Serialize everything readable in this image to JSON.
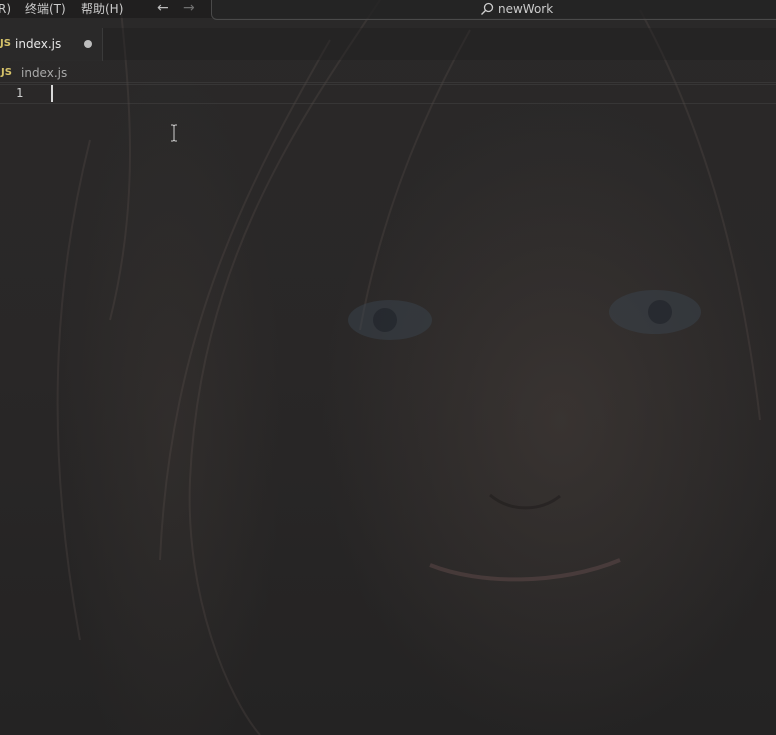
{
  "menu": {
    "items": [
      {
        "id": "selection",
        "label": "R)"
      },
      {
        "id": "terminal",
        "label": "终端(T)"
      },
      {
        "id": "help",
        "label": "帮助(H)"
      }
    ]
  },
  "navigation": {
    "back_icon": "arrow-left-icon",
    "forward_icon": "arrow-right-icon"
  },
  "command_center": {
    "icon": "search-icon",
    "label": "newWork"
  },
  "tabs": [
    {
      "icon_text": "JS",
      "label": "index.js",
      "dirty": true
    }
  ],
  "breadcrumb": {
    "icon_text": "JS",
    "label": "index.js"
  },
  "editor": {
    "lines": [
      {
        "number": "1",
        "text": ""
      }
    ]
  },
  "colors": {
    "js_icon": "#d6c36a",
    "background": "#262525"
  }
}
